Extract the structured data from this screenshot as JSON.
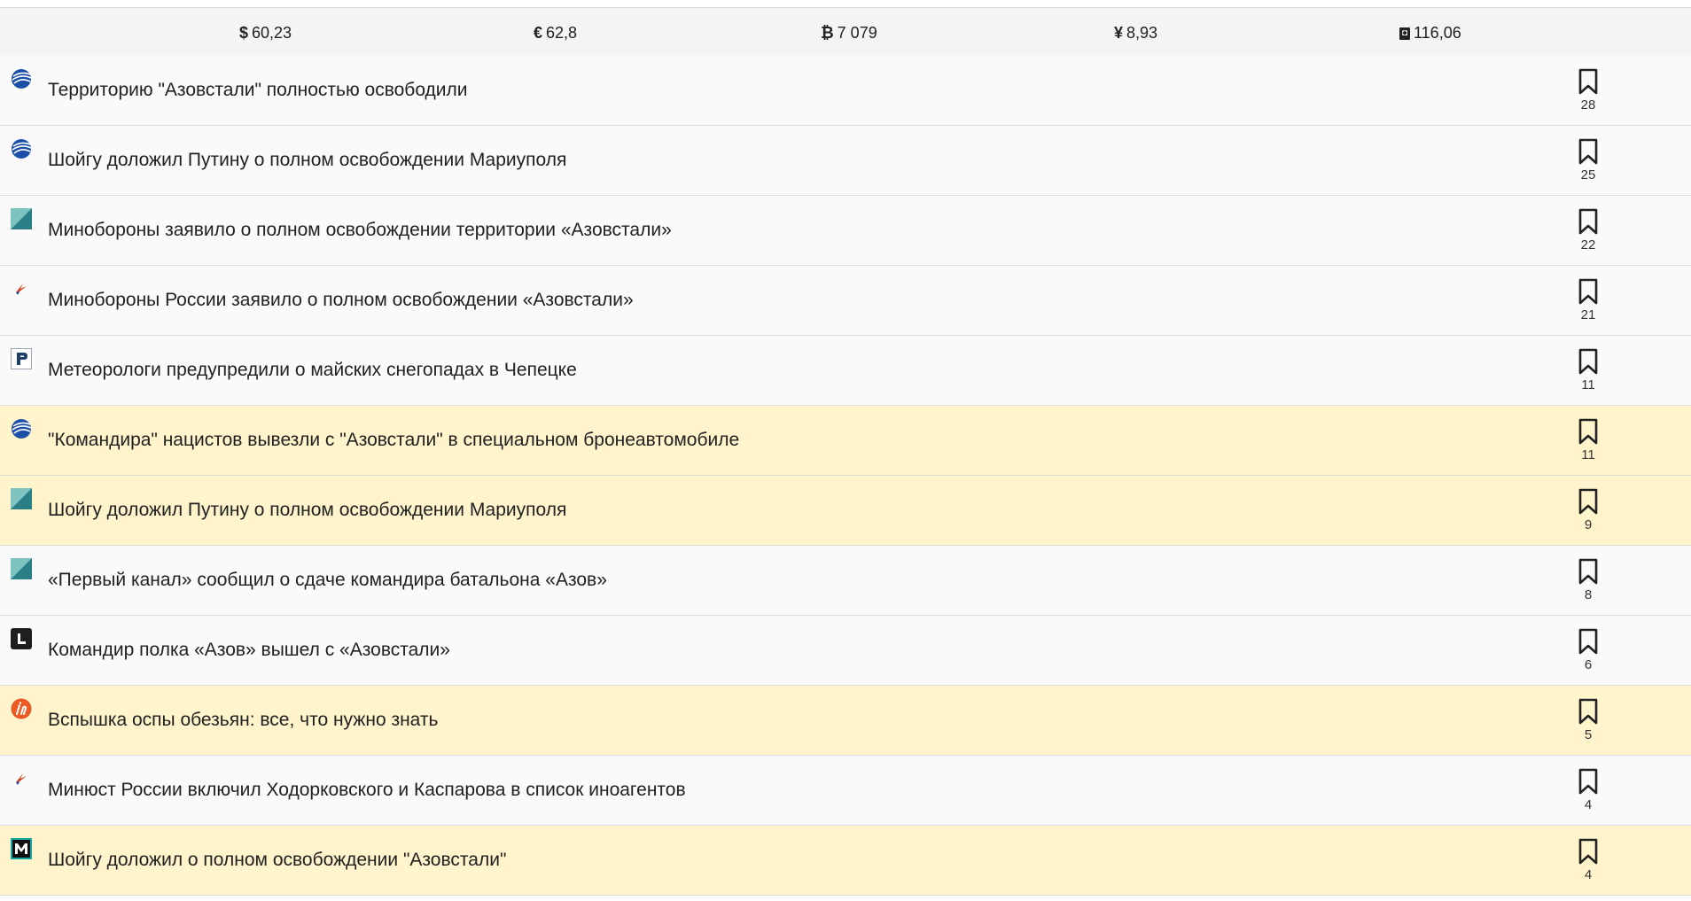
{
  "rates": [
    {
      "currency": "dollar",
      "symbol": "$",
      "value": "60,23"
    },
    {
      "currency": "euro",
      "symbol": "€",
      "value": "62,8"
    },
    {
      "currency": "bitcoin",
      "symbol": "₿",
      "value": "7 079"
    },
    {
      "currency": "yuan",
      "symbol": "¥",
      "value": "8,93"
    },
    {
      "currency": "oil",
      "symbol": "◘",
      "value": "116,06"
    }
  ],
  "news": [
    {
      "title": "Территорию \"Азовстали\" полностью освободили",
      "count": "28",
      "source_icon": "ria-globe-icon",
      "highlighted": false
    },
    {
      "title": "Шойгу доложил Путину о полном освобождении Мариуполя",
      "count": "25",
      "source_icon": "ria-globe-icon",
      "highlighted": false
    },
    {
      "title": "Минобороны заявило о полном освобождении территории «Азовстали»",
      "count": "22",
      "source_icon": "teal-diagonal-icon",
      "highlighted": false
    },
    {
      "title": "Минобороны России заявило о полном освобождении «Азовстали»",
      "count": "21",
      "source_icon": "bird-icon",
      "highlighted": false
    },
    {
      "title": "Метеорологи предупредили о майских снегопадах в Чепецке",
      "count": "11",
      "source_icon": "p-letter-icon",
      "highlighted": false
    },
    {
      "title": "\"Командира\" нацистов вывезли с \"Азовстали\" в специальном бронеавтомобиле",
      "count": "11",
      "source_icon": "ria-globe-icon",
      "highlighted": true
    },
    {
      "title": "Шойгу доложил Путину о полном освобождении Мариуполя",
      "count": "9",
      "source_icon": "teal-diagonal-icon",
      "highlighted": true
    },
    {
      "title": "«Первый канал» сообщил о сдаче командира батальона «Азов»",
      "count": "8",
      "source_icon": "teal-diagonal-icon",
      "highlighted": false
    },
    {
      "title": "Командир полка «Азов» вышел с «Азовстали»",
      "count": "6",
      "source_icon": "l-letter-icon",
      "highlighted": false
    },
    {
      "title": "Вспышка оспы обезьян: все, что нужно знать",
      "count": "5",
      "source_icon": "orange-circle-icon",
      "highlighted": true
    },
    {
      "title": "Минюст России включил Ходорковского и Каспарова в список иноагентов",
      "count": "4",
      "source_icon": "bird-icon",
      "highlighted": false
    },
    {
      "title": "Шойгу доложил о полном освобождении \"Азовстали\"",
      "count": "4",
      "source_icon": "m-letter-icon",
      "highlighted": true
    }
  ],
  "colors": {
    "highlight": "#fff4cc",
    "row_bg": "#fafafa",
    "topbar_bg": "#f4f4f4"
  }
}
